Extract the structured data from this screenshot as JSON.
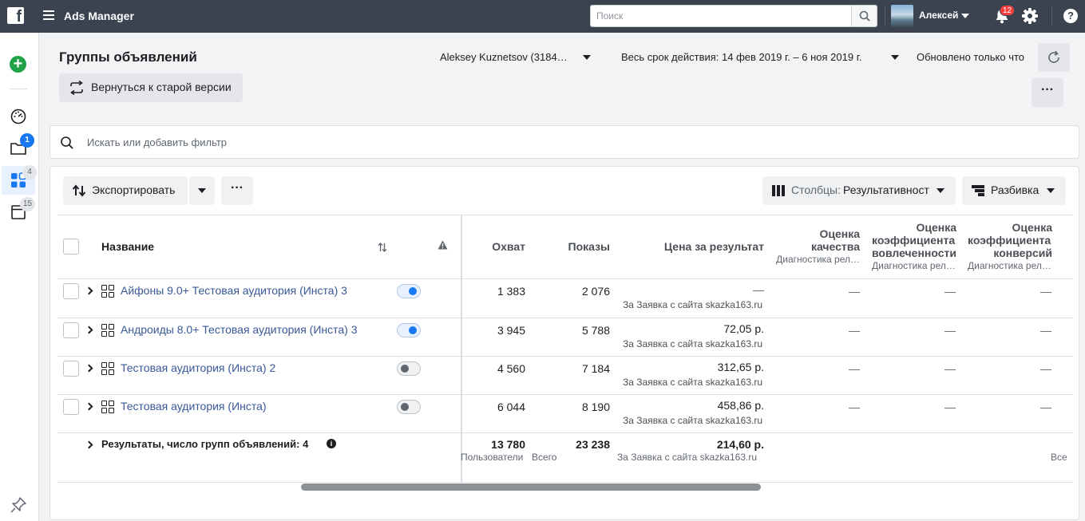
{
  "topbar": {
    "app_title": "Ads Manager",
    "search_placeholder": "Поиск",
    "user_name": "Алексей",
    "notifications_count": "12"
  },
  "rail": {
    "campaigns_badge": "1",
    "adsets_badge": "4",
    "ads_badge": "15"
  },
  "header": {
    "page_title": "Группы объявлений",
    "old_version_label": "Вернуться к старой версии",
    "account": "Aleksey Kuznetsov (3184…",
    "date_range": "Весь срок действия: 14 фев 2019 г. – 6 ноя 2019 г.",
    "updated": "Обновлено только что"
  },
  "filter": {
    "placeholder": "Искать или добавить фильтр"
  },
  "toolbar": {
    "export_label": "Экспортировать",
    "columns_prefix": "Столбцы:",
    "columns_value": "Результативност",
    "breakdown_label": "Разбивка"
  },
  "table": {
    "columns": {
      "name": "Название",
      "reach": "Охват",
      "impressions": "Показы",
      "cost": "Цена за результат",
      "quality_1": "Оценка",
      "quality_2": "качества",
      "quality_sub": "Диагностика рел…",
      "engagement_1": "Оценка",
      "engagement_2": "коэффициента",
      "engagement_3": "вовлеченности",
      "engagement_sub": "Диагностика рел…",
      "conversion_1": "Оценка",
      "conversion_2": "коэффициента",
      "conversion_3": "конверсий",
      "conversion_sub": "Диагностика рел…"
    },
    "rows": [
      {
        "name": "Айфоны 9.0+ Тестовая аудитория (Инста) 3",
        "on": true,
        "reach": "1 383",
        "impressions": "2 076",
        "cost": "—",
        "cost_sub": "За Заявка с сайта skazka163.ru",
        "quality": "—",
        "engagement": "—",
        "conversion": "—"
      },
      {
        "name": "Андроиды 8.0+ Тестовая аудитория (Инста) 3",
        "on": true,
        "reach": "3 945",
        "impressions": "5 788",
        "cost": "72,05 р.",
        "cost_sub": "За Заявка с сайта skazka163.ru",
        "quality": "—",
        "engagement": "—",
        "conversion": "—"
      },
      {
        "name": "Тестовая аудитория (Инста) 2",
        "on": false,
        "reach": "4 560",
        "impressions": "7 184",
        "cost": "312,65 р.",
        "cost_sub": "За Заявка с сайта skazka163.ru",
        "quality": "—",
        "engagement": "—",
        "conversion": "—"
      },
      {
        "name": "Тестовая аудитория (Инста)",
        "on": false,
        "reach": "6 044",
        "impressions": "8 190",
        "cost": "458,86 р.",
        "cost_sub": "За Заявка с сайта skazka163.ru",
        "quality": "—",
        "engagement": "—",
        "conversion": "—"
      }
    ],
    "totals": {
      "label": "Результаты, число групп объявлений: 4",
      "reach": "13 780",
      "reach_sub": "Пользователи",
      "impressions": "23 238",
      "impressions_sub": "Всего",
      "cost": "214,60 р.",
      "cost_sub": "За Заявка с сайта skazka163.ru",
      "last_sub": "Все"
    }
  },
  "colors": {
    "topbar": "#3b4350",
    "accent": "#1877f2",
    "create": "#1fa346",
    "link": "#385898",
    "badge_red": "#fa3e3e"
  }
}
